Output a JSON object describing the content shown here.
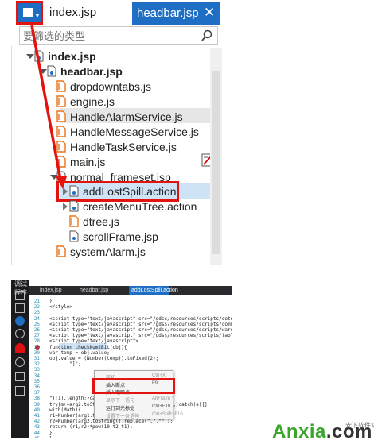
{
  "top_panel": {
    "tabs": {
      "index_label": "index.jsp",
      "active_label": "headbar.jsp",
      "close_glyph": "✕"
    },
    "filter": {
      "placeholder": "要筛选的类型"
    },
    "tree": {
      "items": [
        {
          "label": "index.jsp",
          "icon": "jsp-file-icon"
        },
        {
          "label": "headbar.jsp",
          "icon": "jsp-file-icon"
        },
        {
          "label": "dropdowntabs.js",
          "icon": "js-file-icon"
        },
        {
          "label": "engine.js",
          "icon": "js-file-icon"
        },
        {
          "label": "HandleAlarmService.js",
          "icon": "js-file-icon"
        },
        {
          "label": "HandleMessageService.js",
          "icon": "js-file-icon"
        },
        {
          "label": "HandleTaskService.js",
          "icon": "js-file-icon"
        },
        {
          "label": "main.js",
          "icon": "js-file-icon"
        },
        {
          "label": "normal_frameset.jsp",
          "icon": "jsp-file-icon"
        },
        {
          "label": "addLostSpill.action",
          "icon": "action-file-icon"
        },
        {
          "label": "createMenuTree.action",
          "icon": "action-file-icon"
        },
        {
          "label": "dtree.js",
          "icon": "js-file-icon"
        },
        {
          "label": "scrollFrame.jsp",
          "icon": "jsp-file-icon"
        },
        {
          "label": "systemAlarm.js",
          "icon": "js-file-icon"
        }
      ]
    }
  },
  "bottom_panel": {
    "title": "调试程序",
    "tabs": [
      "index.jsp",
      "headbar.jsp",
      "addLostSpill.action"
    ],
    "line_numbers": [
      "21",
      "22",
      "23",
      "24",
      "25",
      "26",
      "27",
      "28",
      "29",
      "30",
      "31",
      "32",
      "33",
      "34",
      "35",
      "36",
      "37",
      "38",
      "39",
      "40",
      "41",
      "42",
      "43",
      "44",
      "45"
    ],
    "code_lines": [
      "}",
      "</style>",
      "",
      "<script type=\"text/javascript\" src=\"/gdss/resources/scripts/setday.js\"></",
      "<script type=\"text/javascript\" src=\"/gdss/resources/scripts/common.js\"></",
      "<script type=\"text/javascript\" src=\"/gdss/resources/scripts/warehouse.js\"></",
      "<script type=\"text/javascript\" src=\"/gdss/resources/scripts/table.js\"></",
      "<script type=\"text/javascript\">",
      "  function checkNum2Bit(obj){",
      "    var temp = obj.value;",
      "    obj.value = (Number(temp)).toFixed(2);",
      "    ...                      ...\"]\";",
      "",
      "",
      "",
      "",
      "",
      "                    \")[1].length;}catch(e){}",
      "  try{m+=arg2.toString().split(\".\")[1].length;}catch(e){}",
      "  with(Math){",
      "    r1=Number(arg1.toString().replace(\".\",\"\"));",
      "    r2=Number(arg2.toString().replace(\".\",\"\"));",
      "    return (r1/r2)*pow(10,t2-t1);",
      "  }",
      "}"
    ],
    "context_menu": [
      {
        "label": "剪切",
        "shortcut": "Ctrl+X",
        "disabled": true
      },
      {
        "label": "插入断点",
        "shortcut": "F9",
        "disabled": false
      },
      {
        "label": "插入跟踪点",
        "shortcut": "",
        "disabled": false
      },
      {
        "label": "显示下一语句",
        "shortcut": "Alt+Num *",
        "disabled": true
      },
      {
        "label": "运行到光标处",
        "shortcut": "Ctrl+F10",
        "disabled": false
      },
      {
        "label": "设置下一条语句",
        "shortcut": "Ctrl+Shift+F10",
        "disabled": true
      }
    ]
  },
  "logo": {
    "word": "Anxia",
    "dot_suffix": ".com",
    "sub": "安下软件站"
  },
  "colors": {
    "accent_blue": "#1e6fc4",
    "annotation_red": "#e3140d",
    "logo_green": "#3aa52b"
  }
}
